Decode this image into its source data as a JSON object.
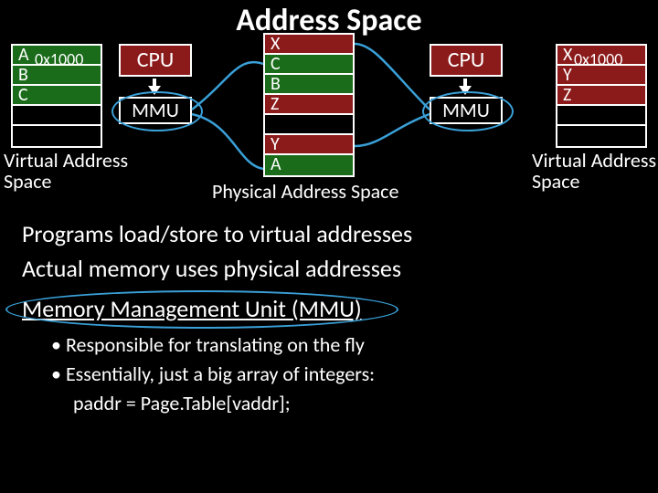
{
  "title": "Address Space",
  "left_vas": {
    "rows": [
      "A",
      "B",
      "C",
      "",
      ""
    ],
    "addr_overlay": "0x1000",
    "label": "Virtual Address\nSpace"
  },
  "right_vas": {
    "rows": [
      "X",
      "Y",
      "Z",
      "",
      ""
    ],
    "addr_overlay": "0x1000",
    "label": "Virtual Address\nSpace"
  },
  "physical": {
    "rows": [
      "X",
      "C",
      "B",
      "Z",
      "",
      "Y",
      "A"
    ],
    "label": "Physical Address Space"
  },
  "cpu_label": "CPU",
  "mmu_label": "MMU",
  "body": {
    "line1": "Programs load/store to virtual addresses",
    "line2": "Actual memory uses physical addresses",
    "line3": "Memory Management Unit (MMU)",
    "bullet1": "Responsible for translating on the fly",
    "bullet2": "Essentially, just a big array of integers:",
    "bullet3": "paddr = Page.Table[vaddr];"
  },
  "colors": {
    "green": "#1a6b1a",
    "red": "#8b1a1a",
    "blue": "#3aa0d8"
  }
}
